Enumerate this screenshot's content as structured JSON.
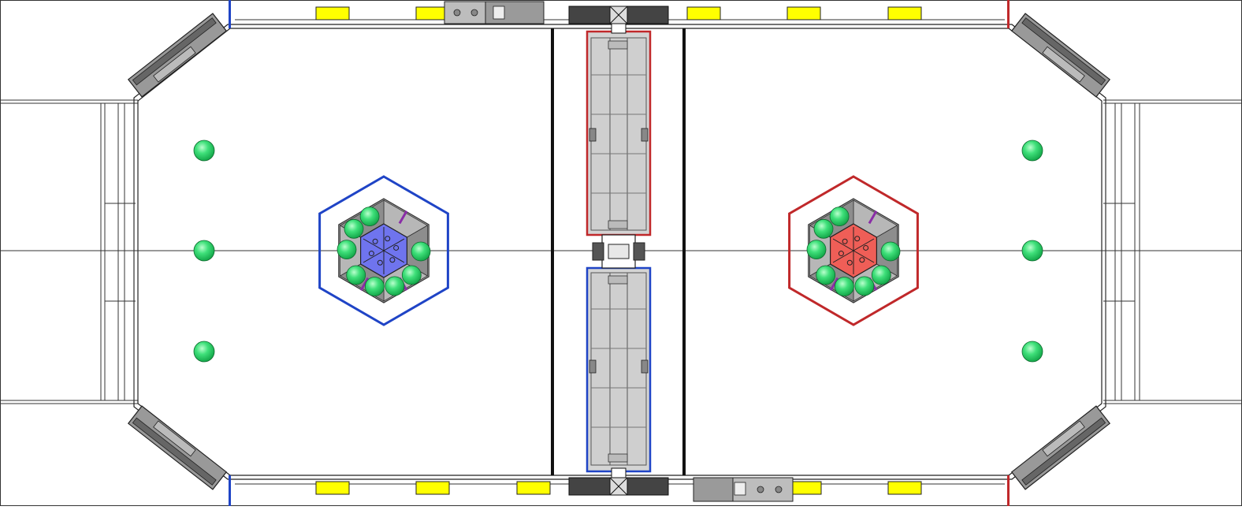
{
  "field": {
    "view": "top-down",
    "alliances": [
      "blue",
      "red"
    ],
    "colors": {
      "background": "#ffffff",
      "outline": "#222222",
      "gray_light": "#d4d4d4",
      "gray_mid": "#a8a8a8",
      "gray_dark": "#555555",
      "yellow": "#ffff00",
      "green_ball": "#33dd66",
      "blue_alliance": "#1f44c6",
      "red_alliance": "#c0282a",
      "blue_hub": "#6f74ee",
      "red_hub": "#ef5e57",
      "purple_accent": "#8a2da7"
    },
    "counts": {
      "field_balls": 6,
      "balls_per_hub": 8,
      "yellow_markers": 12,
      "corner_nets": 4
    }
  }
}
